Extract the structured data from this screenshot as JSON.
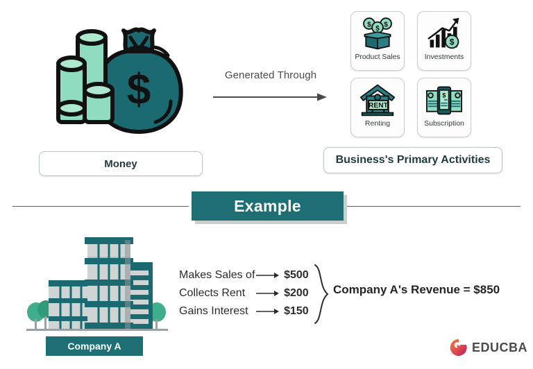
{
  "colors": {
    "teal_dark": "#1e6f74",
    "teal_deep": "#19646b",
    "mint": "#8fdcc0",
    "mint_light": "#aee8cf",
    "outline": "#111111",
    "banner_bg": "#1e6f74",
    "banner_shadow": "#c8cfcf",
    "divider": "#5b5b5b",
    "text_dark": "#2b3a3a",
    "arrow_gray": "#4a4a4a",
    "logo_orange": "#e8603c",
    "logo_magenta": "#c2185b",
    "logo_text": "#4a4a4a"
  },
  "top_section": {
    "money": {
      "icon": "money-bag-and-coins-icon",
      "label": "Money"
    },
    "connector": {
      "label": "Generated Through",
      "icon": "right-arrow-icon"
    },
    "activities": {
      "label": "Business's Primary Activities",
      "tiles": [
        {
          "icon": "box-with-dollar-coins-icon",
          "caption": "Product Sales"
        },
        {
          "icon": "growth-bar-chart-arrow-dollar-icon",
          "caption": "Investments"
        },
        {
          "icon": "house-with-rent-sign-icon",
          "caption": "Renting"
        },
        {
          "icon": "documents-with-dollar-icon",
          "caption": "Subscription"
        }
      ]
    }
  },
  "example_section": {
    "banner_title": "Example",
    "company": {
      "icon": "office-building-icon",
      "label": "Company A"
    },
    "breakdown": [
      {
        "item": "Makes Sales of",
        "amount": "$500"
      },
      {
        "item": "Collects Rent",
        "amount": "$200"
      },
      {
        "item": "Gains Interest",
        "amount": "$150"
      }
    ],
    "brace_icon": "curly-brace-icon",
    "result": "Company A's Revenue = $850"
  },
  "footer": {
    "logo_icon": "educba-swirl-logo-icon",
    "wordmark": "EDUCBA"
  }
}
